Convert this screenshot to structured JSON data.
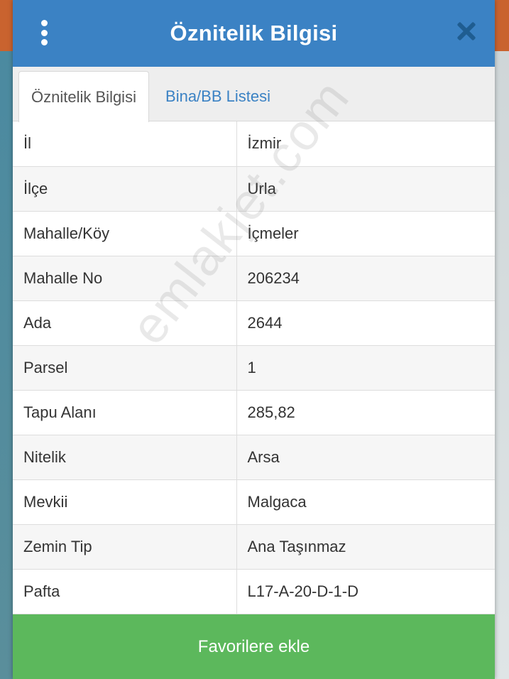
{
  "header": {
    "title": "Öznitelik Bilgisi"
  },
  "tabs": [
    {
      "label": "Öznitelik Bilgisi",
      "active": true
    },
    {
      "label": "Bina/BB Listesi",
      "active": false
    }
  ],
  "attributes": [
    {
      "key": "İl",
      "value": "İzmir"
    },
    {
      "key": "İlçe",
      "value": "Urla"
    },
    {
      "key": "Mahalle/Köy",
      "value": "İçmeler"
    },
    {
      "key": "Mahalle No",
      "value": "206234"
    },
    {
      "key": "Ada",
      "value": "2644"
    },
    {
      "key": "Parsel",
      "value": "1"
    },
    {
      "key": "Tapu Alanı",
      "value": "285,82"
    },
    {
      "key": "Nitelik",
      "value": "Arsa"
    },
    {
      "key": "Mevkii",
      "value": "Malgaca"
    },
    {
      "key": "Zemin Tip",
      "value": "Ana Taşınmaz"
    },
    {
      "key": "Pafta",
      "value": "L17-A-20-D-1-D"
    }
  ],
  "watermark": "emlakjet.com",
  "footer": {
    "favorite_label": "Favorilere ekle"
  },
  "colors": {
    "header": "#3b82c4",
    "tab_link": "#3b82c4",
    "favorite_button": "#5cb85c"
  },
  "icons": {
    "menu": "kebab-menu-icon",
    "close": "close-icon"
  }
}
